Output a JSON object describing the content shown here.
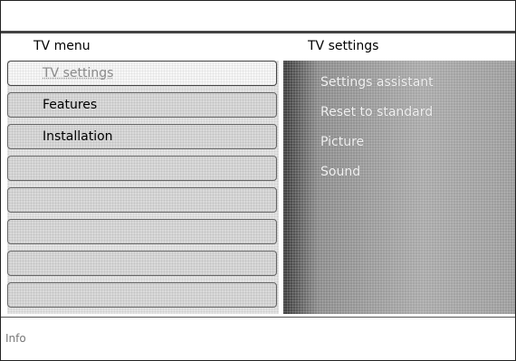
{
  "header": {
    "left_title": "TV menu",
    "right_title": "TV settings"
  },
  "menu": {
    "items": [
      {
        "label": "TV settings",
        "selected": true
      },
      {
        "label": "Features",
        "selected": false
      },
      {
        "label": "Installation",
        "selected": false
      },
      {
        "label": "",
        "selected": false
      },
      {
        "label": "",
        "selected": false
      },
      {
        "label": "",
        "selected": false
      },
      {
        "label": "",
        "selected": false
      },
      {
        "label": "",
        "selected": false
      }
    ]
  },
  "submenu": {
    "items": [
      {
        "label": "Settings assistant"
      },
      {
        "label": "Reset to standard"
      },
      {
        "label": "Picture"
      },
      {
        "label": "Sound"
      }
    ]
  },
  "info": {
    "label": "Info"
  }
}
